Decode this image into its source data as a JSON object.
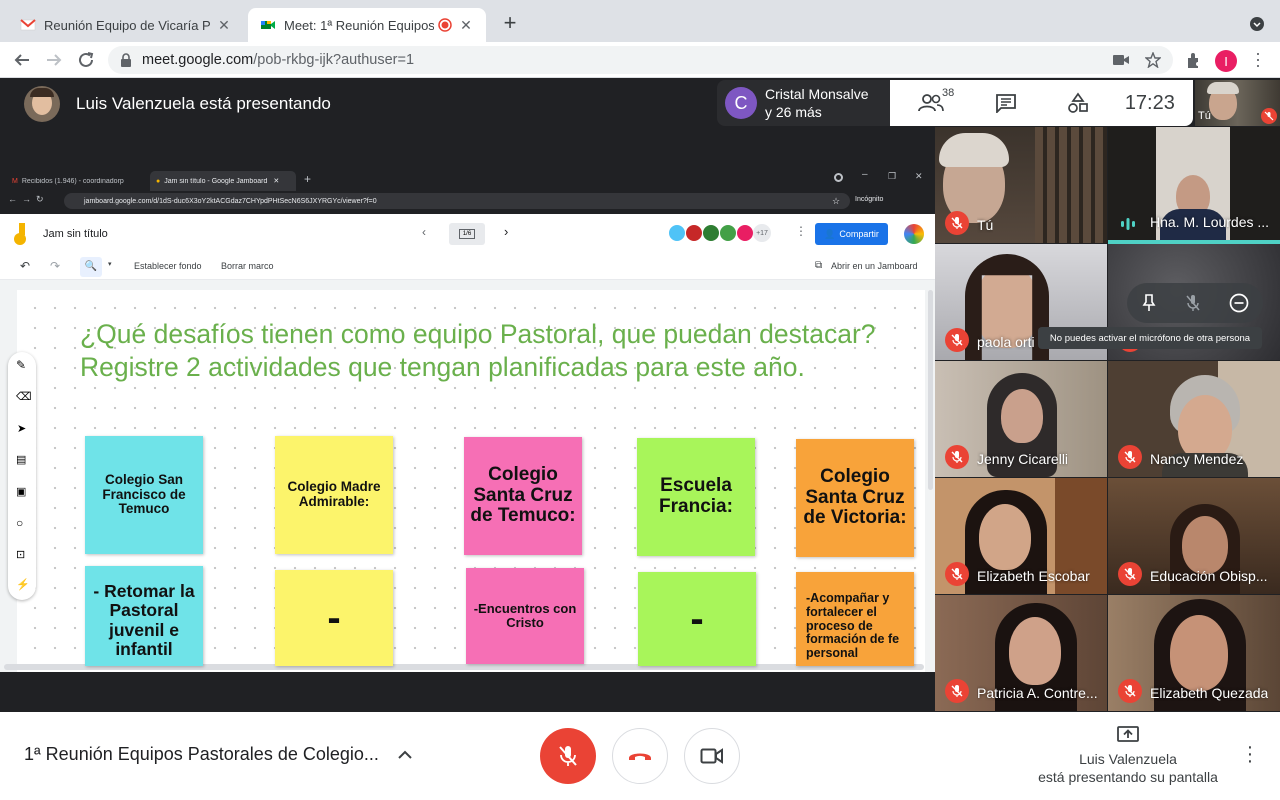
{
  "browser": {
    "tabs": [
      {
        "title": "Reunión Equipo de Vicaría Past",
        "active": false
      },
      {
        "title": "Meet: 1ª Reunión Equipos Pastorales",
        "active": true
      }
    ],
    "url_host": "meet.google.com",
    "url_path": "/pob-rkbg-ijk?authuser=1",
    "profile_initial": "I"
  },
  "meet": {
    "presenter_label": "Luis Valenzuela está presentando",
    "chat_initial": "C",
    "chat_line1": "Cristal Monsalve",
    "chat_line2": "y 26 más",
    "participants_count": "38",
    "time": "17:23",
    "self_label": "Tú",
    "meeting_title": "1ª Reunión Equipos Pastorales de Colegio...",
    "present_status_line1": "Luis Valenzuela",
    "present_status_line2": "está presentando su pantalla",
    "tooltip": "No puedes activar el micrófono de otra persona",
    "tiles": [
      {
        "name": "Tú",
        "muted": true
      },
      {
        "name": "Hna. M. Lourdes ...",
        "muted": false
      },
      {
        "name": "paola orti",
        "muted": true
      },
      {
        "name": "",
        "muted": true
      },
      {
        "name": "Jenny Cicarelli",
        "muted": true
      },
      {
        "name": "Nancy Mendez",
        "muted": true
      },
      {
        "name": "Elizabeth Escobar",
        "muted": true
      },
      {
        "name": "Educación Obisp...",
        "muted": true
      },
      {
        "name": "Patricia A. Contre...",
        "muted": true
      },
      {
        "name": "Elizabeth Quezada",
        "muted": true
      }
    ]
  },
  "shared": {
    "tab1": "Recibidos (1.946) - coordinadorp",
    "tab2": "Jam sin título - Google Jamboard",
    "url": "jamboard.google.com/d/1dS-duc6X3oY2ktACGdaz7CHYpdPHtSecN6S6JXYRGYc/viewer?f=0",
    "incognito": "Incógnito",
    "jam_title": "Jam sin título",
    "page": "1/6",
    "share_btn": "Compartir",
    "plus_count": "+17",
    "tool_bg": "Establecer fondo",
    "tool_clear": "Borrar marco",
    "open_in": "Abrir en un Jamboard",
    "question": "¿Qué desafíos tienen como equipo Pastoral, que puedan destacar? Registre 2 actividades que tengan planificadas para este año.",
    "notes_row1": [
      "Colegio San Francisco de Temuco",
      "Colegio Madre Admirable:",
      "Colegio Santa Cruz de Temuco:",
      "Escuela Francia:",
      "Colegio Santa Cruz de Victoria:"
    ],
    "notes_row2": [
      "- Retomar la Pastoral juvenil e infantil",
      "-",
      "-Encuentros con Cristo",
      "-",
      "-Acompañar y fortalecer el proceso de formación de fe personal"
    ]
  },
  "colors": {
    "meet_red": "#ea4335",
    "question_green": "#6ab04c",
    "note_cyan": "#6fe3e8",
    "note_yellow": "#fcf46b",
    "note_pink": "#f66fb5",
    "note_green": "#a8f55a",
    "note_orange": "#f8a33a"
  }
}
